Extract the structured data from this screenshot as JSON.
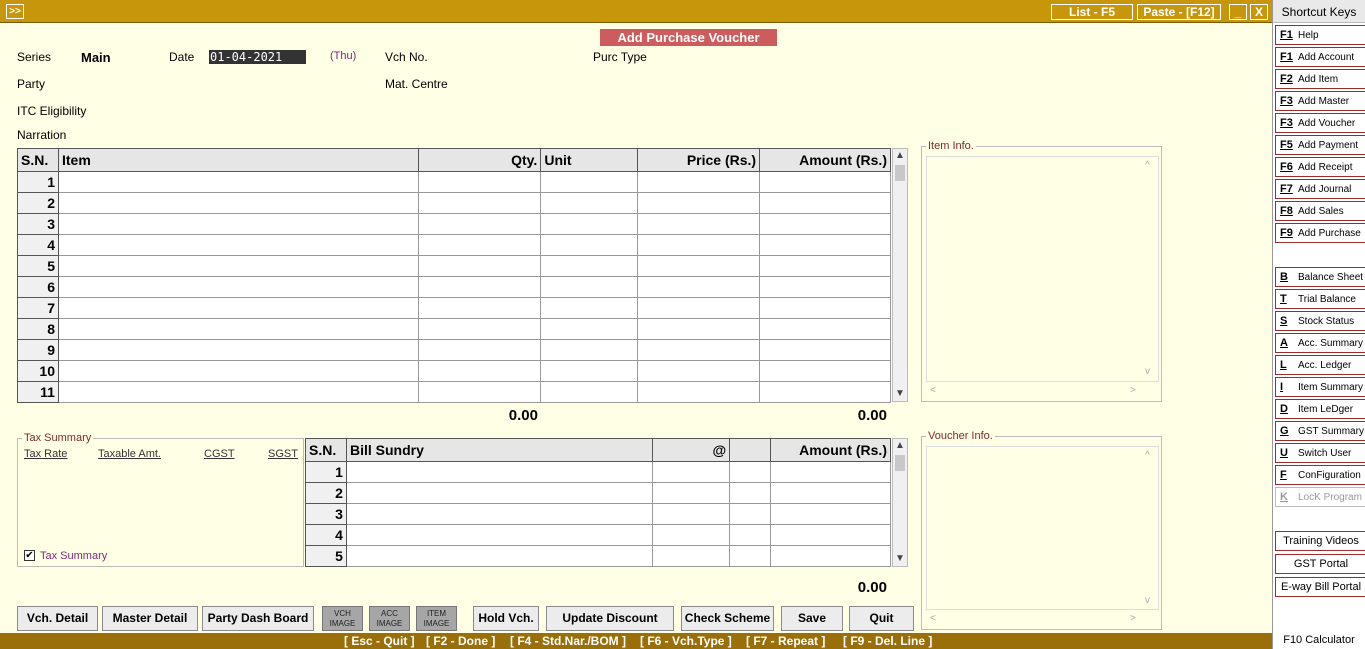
{
  "titlebar": {
    "expand": ">>",
    "list": "List - F5",
    "paste": "Paste - [F12]",
    "minimize": "_",
    "close": "X"
  },
  "header": {
    "title": "Add Purchase Voucher",
    "series_label": "Series",
    "series_value": "Main",
    "date_label": "Date",
    "date_value": "01-04-2021",
    "day": "(Thu)",
    "vch_label": "Vch No.",
    "purc_type_label": "Purc Type",
    "party_label": "Party",
    "mat_centre_label": "Mat. Centre",
    "itc_label": "ITC Eligibility",
    "narration_label": "Narration"
  },
  "items_table": {
    "headers": [
      "S.N.",
      "Item",
      "Qty.",
      "Unit",
      "Price (Rs.)",
      "Amount (Rs.)"
    ],
    "rows": [
      "1",
      "2",
      "3",
      "4",
      "5",
      "6",
      "7",
      "8",
      "9",
      "10",
      "11"
    ],
    "qty_total": "0.00",
    "amount_total": "0.00"
  },
  "item_info": {
    "title": "Item Info."
  },
  "voucher_info": {
    "title": "Voucher Info."
  },
  "tax_summary": {
    "title": "Tax Summary",
    "headers": [
      "Tax Rate",
      "Taxable Amt.",
      "CGST",
      "SGST"
    ],
    "checkbox_label": "Tax Summary",
    "checked": "✔"
  },
  "bill_sundry": {
    "headers": [
      "S.N.",
      "Bill Sundry",
      "@",
      "",
      "Amount (Rs.)"
    ],
    "rows": [
      "1",
      "2",
      "3",
      "4",
      "5"
    ],
    "amount_total": "0.00"
  },
  "buttons": {
    "vch_detail": "Vch. Detail",
    "master_detail": "Master Detail",
    "party_dash": "Party Dash Board",
    "vch_image_1": "VCH",
    "vch_image_2": "IMAGE",
    "acc_image_1": "ACC",
    "acc_image_2": "IMAGE",
    "item_image_1": "ITEM",
    "item_image_2": "IMAGE",
    "hold": "Hold Vch.",
    "update_discount": "Update Discount",
    "check_scheme": "Check Scheme",
    "save": "Save",
    "quit": "Quit"
  },
  "statusbar": {
    "items": [
      "[ Esc - Quit ]",
      "[ F2 - Done ]",
      "[ F4 - Std.Nar./BOM ]",
      "[ F6 - Vch.Type ]",
      "[ F7 - Repeat ]",
      "[ F9 - Del. Line ]"
    ]
  },
  "sidebar": {
    "title": "Shortcut Keys",
    "shortcuts": [
      {
        "key": "F1",
        "label": "Help"
      },
      {
        "key": "F1",
        "label": "Add Account"
      },
      {
        "key": "F2",
        "label": "Add Item"
      },
      {
        "key": "F3",
        "label": "Add Master"
      },
      {
        "key": "F3",
        "label": "Add Voucher"
      },
      {
        "key": "F5",
        "label": "Add Payment"
      },
      {
        "key": "F6",
        "label": "Add Receipt"
      },
      {
        "key": "F7",
        "label": "Add Journal"
      },
      {
        "key": "F8",
        "label": "Add Sales"
      },
      {
        "key": "F9",
        "label": "Add Purchase"
      }
    ],
    "reports": [
      {
        "key": "B",
        "label": "Balance Sheet"
      },
      {
        "key": "T",
        "label": "Trial Balance"
      },
      {
        "key": "S",
        "label": "Stock Status"
      },
      {
        "key": "A",
        "label": "Acc. Summary"
      },
      {
        "key": "L",
        "label": "Acc. Ledger"
      },
      {
        "key": "I",
        "label": "Item Summary"
      },
      {
        "key": "D",
        "label": "Item LeDger"
      },
      {
        "key": "G",
        "label": "GST Summary"
      },
      {
        "key": "U",
        "label": "Switch User"
      },
      {
        "key": "F",
        "label": "ConFiguration"
      },
      {
        "key": "K",
        "label": "LocK Program"
      }
    ],
    "training": "Training Videos",
    "gst_portal": "GST Portal",
    "eway": "E-way Bill Portal",
    "calculator": "F10 Calculator"
  }
}
